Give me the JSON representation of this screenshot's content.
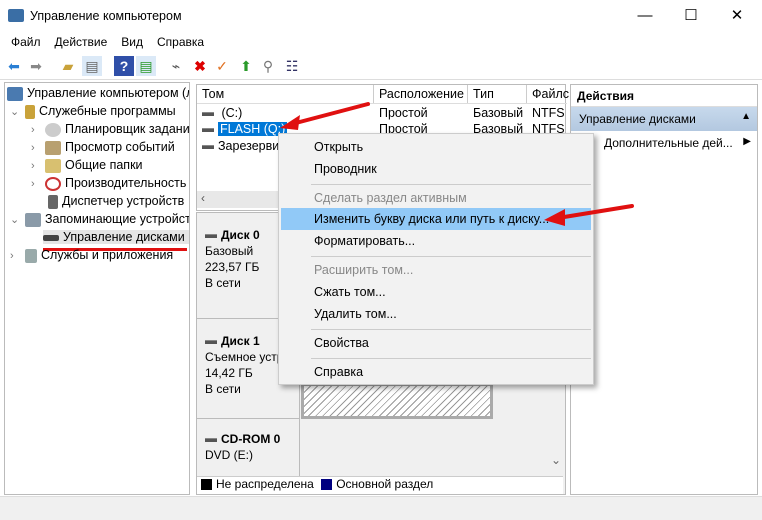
{
  "window": {
    "title": "Управление компьютером",
    "minimize": "—",
    "maximize": "☐",
    "close": "✕"
  },
  "menu": [
    "Файл",
    "Действие",
    "Вид",
    "Справка"
  ],
  "tree": {
    "root": "Управление компьютером (л",
    "utilities": "Служебные программы",
    "task_scheduler": "Планировщик заданий",
    "event_viewer": "Просмотр событий",
    "shared_folders": "Общие папки",
    "performance": "Производительность",
    "device_manager": "Диспетчер устройств",
    "storage": "Запоминающие устройст",
    "disk_management": "Управление дисками",
    "services": "Службы и приложения"
  },
  "volumes": {
    "headers": [
      "Том",
      "Расположение",
      "Тип",
      "Файлс"
    ],
    "rows": [
      [
        "(C:)",
        "Простой",
        "Базовый",
        "NTFS"
      ],
      [
        "FLASH (Q:)",
        "Простой",
        "Базовый",
        "NTFS"
      ],
      [
        "Зарезервир",
        "",
        "",
        ""
      ]
    ]
  },
  "disks": [
    {
      "name": "Диск 0",
      "type": "Базовый",
      "size": "223,57 ГБ",
      "status": "В сети"
    },
    {
      "name": "Диск 1",
      "type": "Съемное устр",
      "size": "14,42 ГБ",
      "status": "В сети"
    },
    {
      "name": "CD-ROM 0",
      "type": "DVD (E:)",
      "size": "",
      "status": ""
    }
  ],
  "legend": {
    "unallocated": "Не распределена",
    "primary": "Основной раздел",
    "colors": {
      "unallocated": "#000000",
      "primary": "#000080"
    }
  },
  "actions": {
    "title": "Действия",
    "section": "Управление дисками",
    "more": "Дополнительные дей..."
  },
  "context_menu": {
    "open": "Открыть",
    "explorer": "Проводник",
    "mark_active": "Сделать раздел активным",
    "change_letter": "Изменить букву диска или путь к диску...",
    "format": "Форматировать...",
    "extend": "Расширить том...",
    "shrink": "Сжать том...",
    "delete": "Удалить том...",
    "properties": "Свойства",
    "help": "Справка"
  }
}
